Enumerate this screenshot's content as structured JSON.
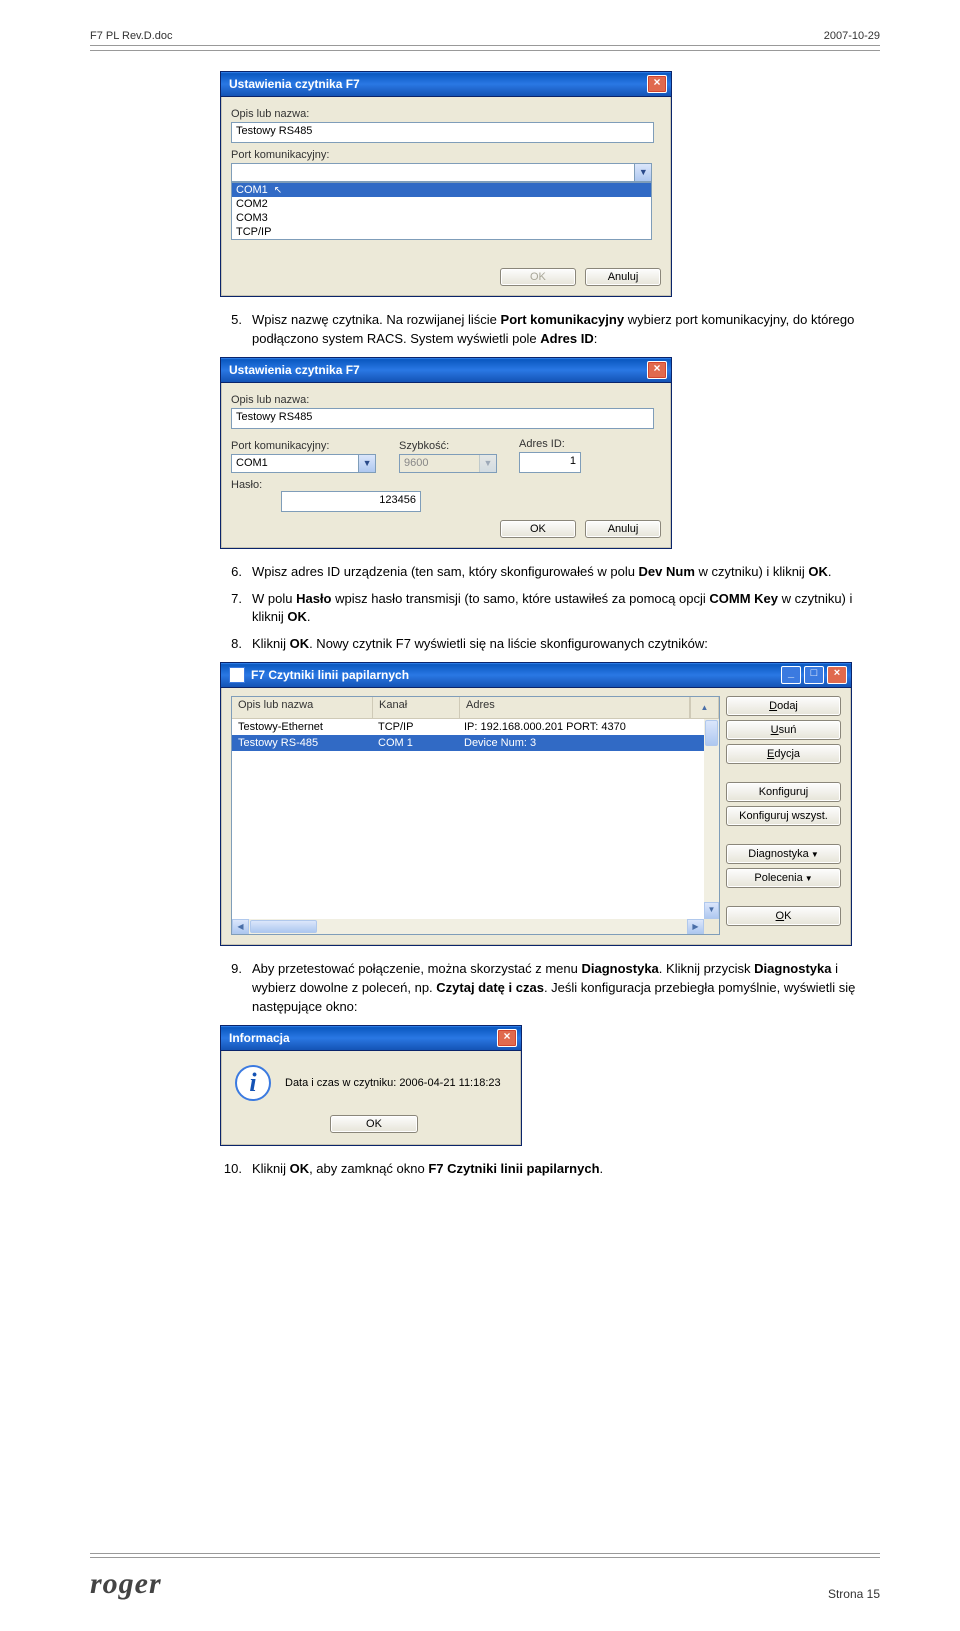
{
  "header": {
    "left": "F7 PL Rev.D.doc",
    "right": "2007-10-29"
  },
  "footer": {
    "logo": "roger",
    "page": "Strona 15"
  },
  "steps": {
    "s5": {
      "num": "5.",
      "t1": "Wpisz nazwę czytnika. Na rozwijanej liście ",
      "b1": "Port komunikacyjny",
      "t2": " wybierz port komunikacyjny, do którego podłączono system RACS. System wyświetli pole ",
      "b2": "Adres ID",
      "t3": ":"
    },
    "s6": {
      "num": "6.",
      "t1": "Wpisz adres ID urządzenia (ten sam, który skonfigurowałeś w polu ",
      "b1": "Dev Num",
      "t2": " w czytniku) i kliknij ",
      "b2": "OK",
      "t3": "."
    },
    "s7": {
      "num": "7.",
      "t1": "W polu ",
      "b1": "Hasło",
      "t2": " wpisz hasło transmisji (to samo, które ustawiłeś za pomocą opcji ",
      "b2": "COMM Key",
      "t3": " w czytniku) i kliknij ",
      "b3": "OK",
      "t4": "."
    },
    "s8": {
      "num": "8.",
      "t1": "Kliknij ",
      "b1": "OK",
      "t2": ". Nowy czytnik F7 wyświetli się na liście skonfigurowanych czytników:"
    },
    "s9": {
      "num": "9.",
      "t1": "Aby przetestować połączenie, można skorzystać z menu ",
      "b1": "Diagnostyka",
      "t2": ". Kliknij przycisk ",
      "b2": "Diagnostyka",
      "t3": " i wybierz dowolne z poleceń, np. ",
      "b3": "Czytaj datę i czas",
      "t4": ". Jeśli konfiguracja przebiegła pomyślnie, wyświetli się następujące okno:"
    },
    "s10": {
      "num": "10.",
      "t1": "Kliknij ",
      "b1": "OK",
      "t2": ", aby zamknąć okno ",
      "b2": "F7 Czytniki linii papilarnych",
      "t3": "."
    }
  },
  "win1": {
    "title": "Ustawienia czytnika F7",
    "opis_label": "Opis lub nazwa:",
    "opis_value": "Testowy RS485",
    "port_label": "Port komunikacyjny:",
    "port_value": "",
    "options": [
      "COM1",
      "COM2",
      "COM3",
      "TCP/IP"
    ],
    "ok": "OK",
    "anuluj": "Anuluj"
  },
  "win2": {
    "title": "Ustawienia czytnika F7",
    "opis_label": "Opis lub nazwa:",
    "opis_value": "Testowy RS485",
    "port_label": "Port komunikacyjny:",
    "port_value": "COM1",
    "szybkosc_label": "Szybkość:",
    "szybkosc_value": "9600",
    "adres_label": "Adres ID:",
    "adres_value": "1",
    "haslo_label": "Hasło:",
    "haslo_value": "123456",
    "ok": "OK",
    "anuluj": "Anuluj"
  },
  "win3": {
    "title": "F7 Czytniki linii papilarnych",
    "headers": {
      "c1": "Opis lub nazwa",
      "c2": "Kanał",
      "c3": "Adres"
    },
    "rows": [
      {
        "c1": "Testowy-Ethernet",
        "c2": "TCP/IP",
        "c3": "IP: 192.168.000.201 PORT: 4370"
      },
      {
        "c1": "Testowy RS-485",
        "c2": "COM 1",
        "c3": "Device Num: 3"
      }
    ],
    "buttons": {
      "dodaj": "Dodaj",
      "usun": "Usuń",
      "edycja": "Edycja",
      "konfiguruj": "Konfiguruj",
      "konfall": "Konfiguruj wszyst.",
      "diag": "Diagnostyka",
      "polecenia": "Polecenia",
      "ok": "OK"
    }
  },
  "win4": {
    "title": "Informacja",
    "msg": "Data i czas w czytniku: 2006-04-21 11:18:23",
    "ok": "OK"
  }
}
